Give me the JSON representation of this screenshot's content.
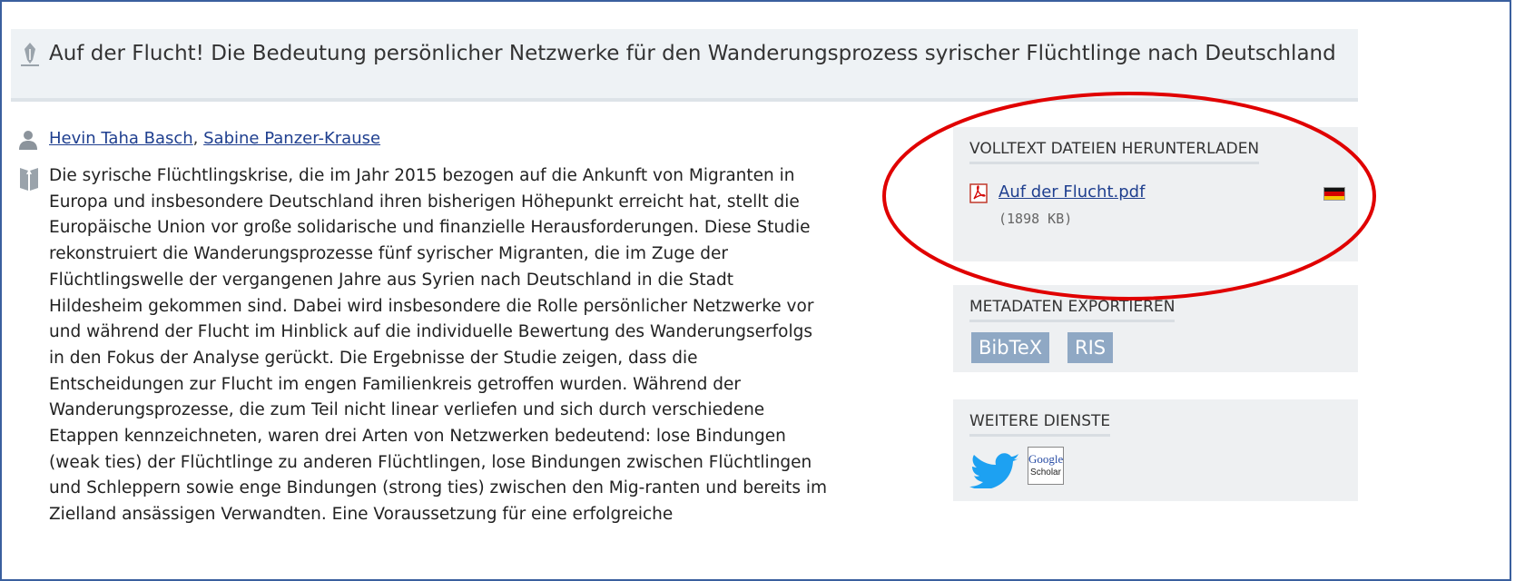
{
  "title": "Auf der Flucht! Die Bedeutung persönlicher Netzwerke für den Wanderungsprozess syrischer Flüchtlinge nach Deutschland",
  "authors": [
    {
      "name": "Hevin Taha Basch"
    },
    {
      "name": "Sabine Panzer-Krause"
    }
  ],
  "author_separator": ", ",
  "abstract": "Die syrische Flüchtlingskrise, die im Jahr 2015 bezogen auf die Ankunft von Migranten in Europa und insbesondere Deutschland ihren bisherigen Höhepunkt erreicht hat, stellt die Europäische Union vor große solidarische und finanzielle Herausforderungen. Diese Studie rekonstruiert die Wanderungsprozesse fünf syrischer Migranten, die im Zuge der Flüchtlingswelle der vergangenen Jahre aus Syrien nach Deutschland in die Stadt Hildesheim gekommen sind. Dabei wird insbesondere die Rolle persönlicher Netzwerke vor und während der Flucht im Hinblick auf die individuelle Bewertung des Wanderungserfolgs in den Fokus der Analyse gerückt. Die Ergebnisse der Studie zeigen, dass die Entscheidungen zur Flucht im engen Familienkreis getroffen wurden. Während der Wanderungsprozesse, die zum Teil nicht linear verliefen und sich durch verschiedene Etappen kennzeichneten, waren drei Arten von Netzwerken bedeutend: lose Bindungen (weak ties) der Flüchtlinge zu anderen Flüchtlingen, lose Bindungen zwischen Flüchtlingen und Schleppern sowie enge Bindungen (strong ties) zwischen den Mig-ranten und bereits im Zielland ansässigen Verwandten. Eine Voraussetzung für eine erfolgreiche",
  "sidebar": {
    "download": {
      "heading": "VOLLTEXT DATEIEN HERUNTERLADEN",
      "file_name": "Auf der Flucht.pdf",
      "file_size": "(1898 KB)",
      "file_icon": "pdf-icon",
      "language_flag": "german-flag-icon"
    },
    "export": {
      "heading": "METADATEN EXPORTIEREN",
      "buttons": [
        "BibTeX",
        "RIS"
      ]
    },
    "services": {
      "heading": "WEITERE DIENSTE",
      "icons": [
        "twitter-icon",
        "google-scholar-icon"
      ],
      "scholar_text_1": "Google",
      "scholar_text_2": "Scholar"
    }
  },
  "colors": {
    "link": "#1f3f8f",
    "panel_bg": "#eef0f2",
    "button_bg": "#8fa8c4",
    "annotation_ellipse": "#e00000",
    "frame_border": "#3a5f9e"
  }
}
